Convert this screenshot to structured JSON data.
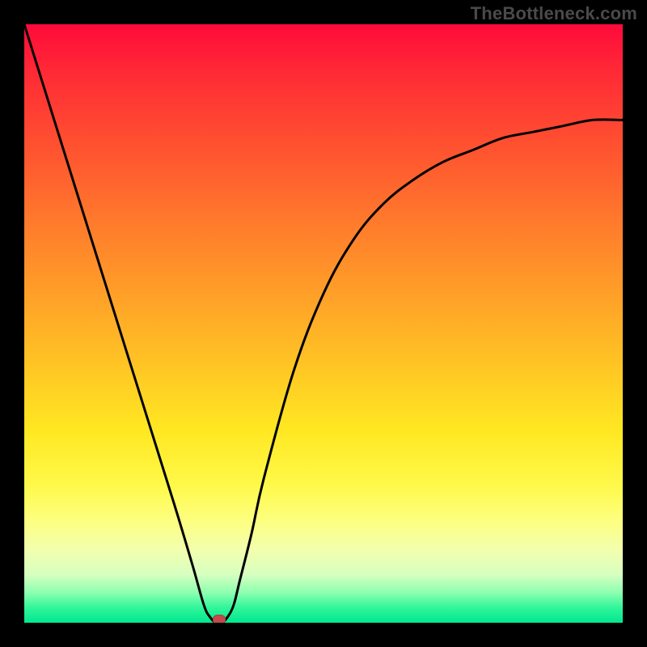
{
  "watermark": "TheBottleneck.com",
  "chart_data": {
    "type": "line",
    "title": "",
    "xlabel": "",
    "ylabel": "",
    "xlim": [
      0,
      100
    ],
    "ylim": [
      0,
      100
    ],
    "grid": false,
    "legend": false,
    "background": "red-yellow-green vertical gradient",
    "series": [
      {
        "name": "bottleneck-curve",
        "x": [
          0,
          5,
          10,
          15,
          20,
          25,
          28,
          30,
          31,
          32,
          33,
          34,
          35,
          36,
          38,
          40,
          45,
          50,
          55,
          60,
          65,
          70,
          75,
          80,
          85,
          90,
          95,
          100
        ],
        "values": [
          100,
          84,
          68,
          52,
          36,
          20,
          10,
          3,
          1,
          0,
          0,
          1,
          3,
          7,
          15,
          24,
          42,
          55,
          64,
          70,
          74,
          77,
          79,
          81,
          82,
          83,
          84,
          84
        ]
      }
    ],
    "marker": {
      "x": 32.5,
      "y": 0
    },
    "gradient_stops": [
      {
        "pos": 0,
        "color": "#ff0a3a"
      },
      {
        "pos": 0.5,
        "color": "#ffc824"
      },
      {
        "pos": 0.85,
        "color": "#fdff80"
      },
      {
        "pos": 1.0,
        "color": "#00e890"
      }
    ]
  }
}
